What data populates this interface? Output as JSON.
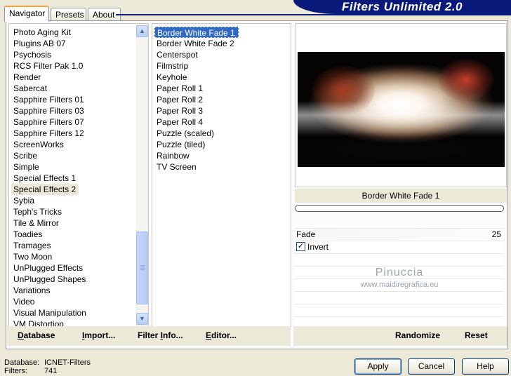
{
  "tabs": [
    {
      "label": "Navigator",
      "active": true
    },
    {
      "label": "Presets",
      "active": false
    },
    {
      "label": "About",
      "active": false
    }
  ],
  "banner": {
    "title": "Filters Unlimited 2.0"
  },
  "categories": {
    "items": [
      "Photo Aging Kit",
      "Plugins AB 07",
      "Psychosis",
      "RCS Filter Pak 1.0",
      "Render",
      "Sabercat",
      "Sapphire Filters 01",
      "Sapphire Filters 03",
      "Sapphire Filters 07",
      "Sapphire Filters 12",
      "ScreenWorks",
      "Scribe",
      "Simple",
      "Special Effects 1",
      "Special Effects 2",
      "Sybia",
      "Teph's Tricks",
      "Tile & Mirror",
      "Toadies",
      "Tramages",
      "Two Moon",
      "UnPlugged Effects",
      "UnPlugged Shapes",
      "Variations",
      "Video",
      "Visual Manipulation",
      "VM Distortion"
    ],
    "selected": "Special Effects 2"
  },
  "filters": {
    "items": [
      "Border White Fade 1",
      "Border White Fade 2",
      "Centerspot",
      "Filmstrip",
      "Keyhole",
      "Paper Roll 1",
      "Paper Roll 2",
      "Paper Roll 3",
      "Paper Roll 4",
      "Puzzle (scaled)",
      "Puzzle (tiled)",
      "Rainbow",
      "TV Screen"
    ],
    "selected": "Border White Fade 1"
  },
  "preview": {
    "filter_name": "Border White Fade 1"
  },
  "params": {
    "fade_label": "Fade",
    "fade_value": "25",
    "invert_label": "Invert",
    "invert_checked": true
  },
  "watermark": {
    "line1": "Pinuccia",
    "line2": "www.maidiregrafica.eu"
  },
  "footer_left": {
    "database": {
      "prefix": "D",
      "rest": "atabase"
    },
    "import": {
      "prefix": "I",
      "rest": "mport..."
    },
    "filter_info": {
      "pre": "Filter ",
      "prefix": "I",
      "rest": "nfo..."
    },
    "editor": {
      "prefix": "E",
      "rest": "ditor..."
    }
  },
  "footer_right": {
    "randomize": "Randomize",
    "reset": "Reset"
  },
  "status": {
    "database_label": "Database:",
    "database_value": "ICNET-Filters",
    "filters_label": "Filters:",
    "filters_value": "741"
  },
  "buttons": {
    "apply": "Apply",
    "cancel": "Cancel",
    "help": "Help"
  },
  "scrollbar": {
    "position": 0.69
  }
}
